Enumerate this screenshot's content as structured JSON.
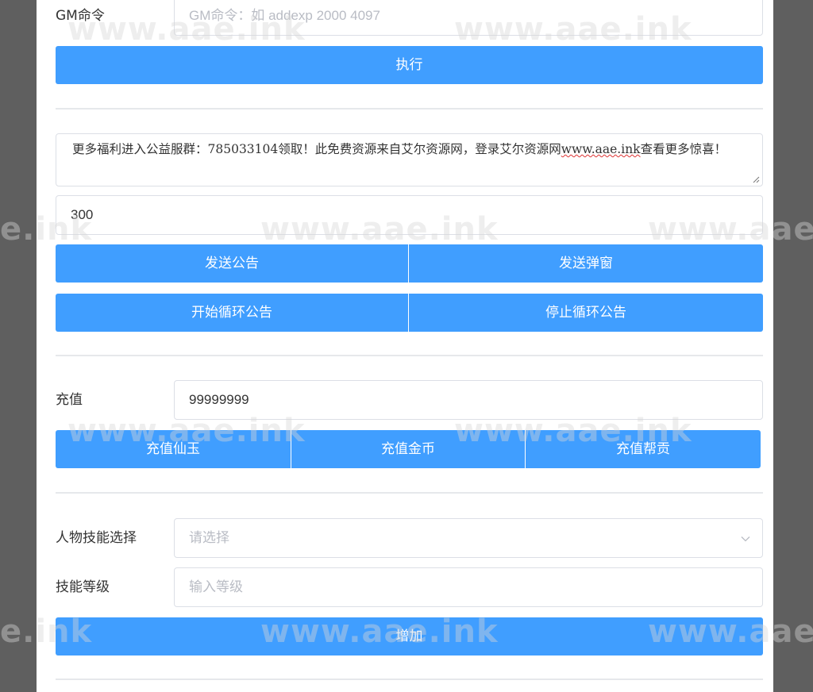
{
  "gm": {
    "label": "GM命令",
    "placeholder": "GM命令：如 addexp 2000 4097",
    "execute_label": "执行"
  },
  "announcement": {
    "text_before_link": "更多福利进入公益服群：785033104领取！此免费资源来自艾尔资源网，登录艾尔资源网",
    "link_text": "www.aae.ink",
    "text_after_link": "查看更多惊喜！",
    "interval_value": "300",
    "send_announcement_label": "发送公告",
    "send_popup_label": "发送弹窗",
    "start_loop_label": "开始循环公告",
    "stop_loop_label": "停止循环公告"
  },
  "recharge": {
    "label": "充值",
    "amount_value": "99999999",
    "xianyu_label": "充值仙玉",
    "gold_label": "充值金币",
    "guild_label": "充值帮贡"
  },
  "skill": {
    "select_label": "人物技能选择",
    "select_placeholder": "请选择",
    "level_label": "技能等级",
    "level_placeholder": "输入等级",
    "add_label": "增加"
  },
  "watermark_text": "www.aae.ink",
  "watermark_fragment": "e.ink",
  "colors": {
    "primary": "#409eff",
    "backdrop": "#5f5f5f",
    "panel": "#ffffff",
    "border": "#dcdfe6",
    "placeholder": "#b9bcc4"
  },
  "icons": [
    "resize-handle-icon",
    "chevron-down-icon"
  ]
}
